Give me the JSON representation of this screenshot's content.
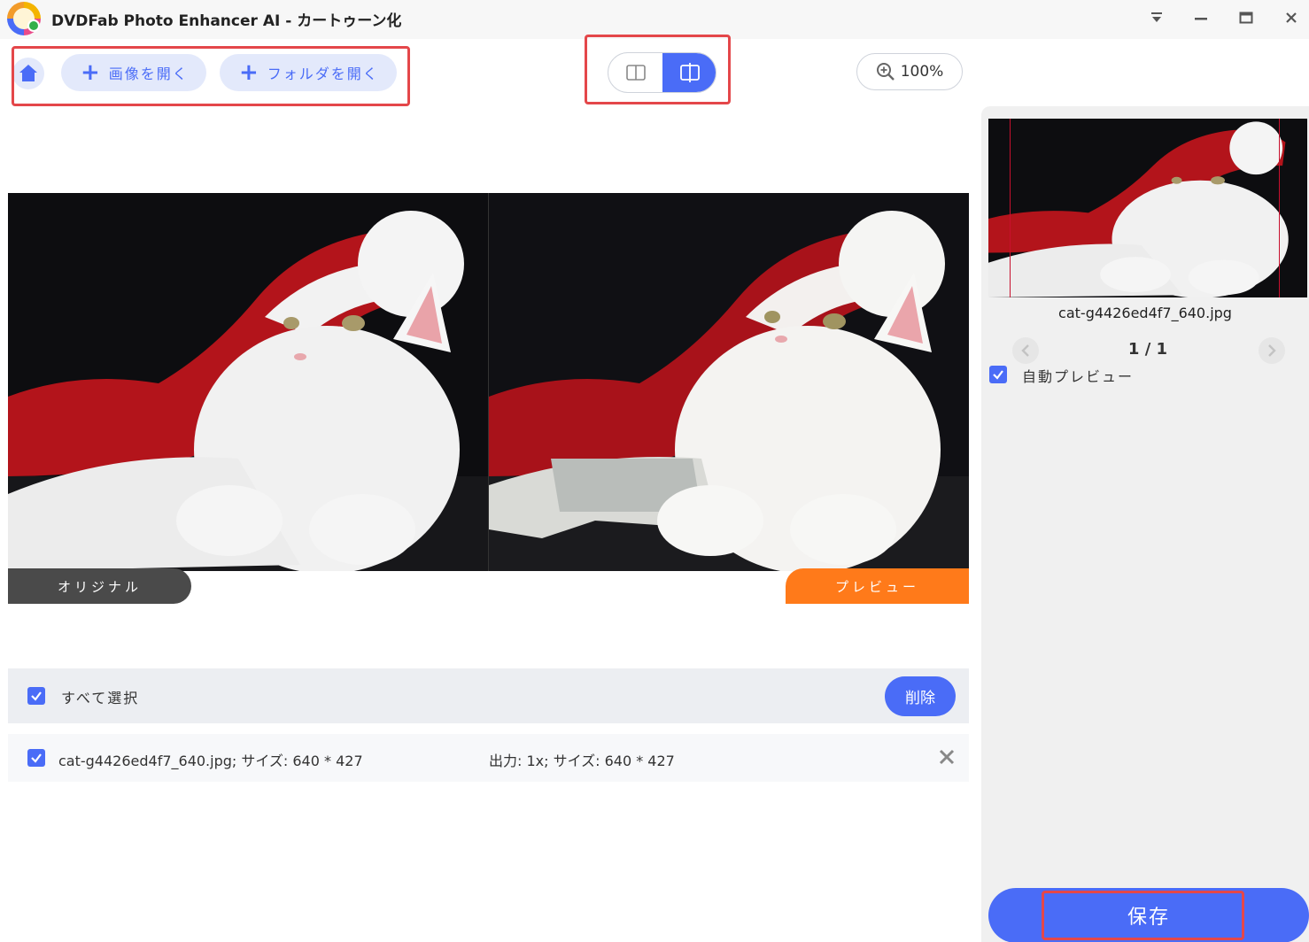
{
  "window": {
    "title": "DVDFab Photo Enhancer AI - カートゥーン化"
  },
  "toolbar": {
    "open_image_label": "画像を開く",
    "open_folder_label": "フォルダを開く",
    "zoom_level": "100%"
  },
  "compare": {
    "original_label": "オリジナル",
    "preview_label": "プレビュー"
  },
  "list": {
    "select_all_label": "すべて選択",
    "delete_label": "削除",
    "files": [
      {
        "info": "cat-g4426ed4f7_640.jpg; サイズ: 640 * 427",
        "output": "出力: 1x; サイズ: 640 * 427"
      }
    ]
  },
  "side": {
    "thumb_filename": "cat-g4426ed4f7_640.jpg",
    "page_indicator": "1 / 1",
    "auto_preview_label": "自動プレビュー",
    "save_label": "保存"
  },
  "colors": {
    "accent": "#4a6cf7",
    "preview_orange": "#ff7a1a",
    "highlight_red": "#e4474a"
  }
}
